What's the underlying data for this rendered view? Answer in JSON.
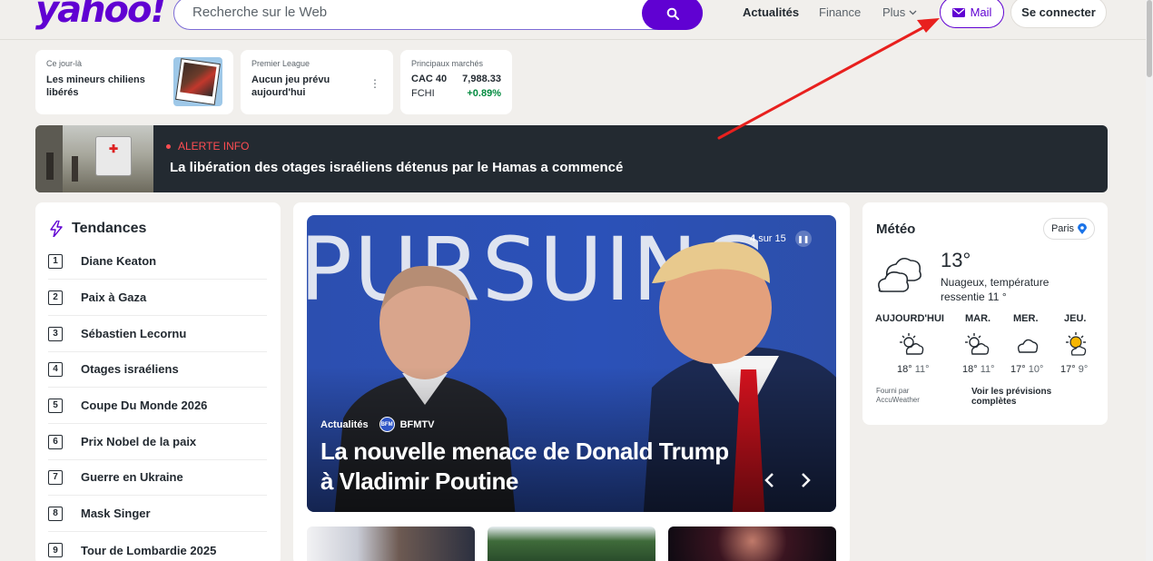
{
  "header": {
    "logo": "yahoo!",
    "search_placeholder": "Recherche sur le Web",
    "nav": [
      "Actualités",
      "Finance",
      "Plus"
    ],
    "mail_label": "Mail",
    "connect_label": "Se connecter"
  },
  "ticker": {
    "on_this_day": {
      "label": "Ce jour-là",
      "title": "Les mineurs chiliens libérés"
    },
    "sport": {
      "label": "Premier League",
      "title": "Aucun jeu prévu aujourd'hui"
    },
    "markets": {
      "label": "Principaux marchés",
      "rows": [
        {
          "name": "CAC 40",
          "value": "7,988.33"
        },
        {
          "name": "FCHI",
          "value": "+0.89%"
        }
      ]
    }
  },
  "breaking": {
    "label": "ALERTE INFO",
    "title": "La libération des otages israéliens détenus par le Hamas a commencé"
  },
  "trends": {
    "title": "Tendances",
    "items": [
      {
        "num": "1",
        "label": "Diane Keaton"
      },
      {
        "num": "2",
        "label": "Paix à Gaza"
      },
      {
        "num": "3",
        "label": "Sébastien Lecornu"
      },
      {
        "num": "4",
        "label": "Otages israéliens"
      },
      {
        "num": "5",
        "label": "Coupe Du Monde 2026"
      },
      {
        "num": "6",
        "label": "Prix Nobel de la paix"
      },
      {
        "num": "7",
        "label": "Guerre en Ukraine"
      },
      {
        "num": "8",
        "label": "Mask Singer"
      },
      {
        "num": "9",
        "label": "Tour de Lombardie 2025"
      }
    ]
  },
  "hero": {
    "bg_text": "PURSUING",
    "counter_current": "4",
    "counter_rest": "sur 15",
    "category": "Actualités",
    "source": "BFMTV",
    "source_logo": "BFM",
    "title": "La nouvelle menace de Donald Trump à Vladimir Poutine"
  },
  "weather": {
    "title": "Météo",
    "location": "Paris",
    "temp": "13°",
    "description": "Nuageux, température ressentie 11 °",
    "days": [
      {
        "day": "AUJOURD'HUI",
        "hi": "18°",
        "lo": "11°",
        "icon": "partly-sunny-icon"
      },
      {
        "day": "MAR.",
        "hi": "18°",
        "lo": "11°",
        "icon": "partly-sunny-icon"
      },
      {
        "day": "MER.",
        "hi": "17°",
        "lo": "10°",
        "icon": "cloud-icon"
      },
      {
        "day": "JEU.",
        "hi": "17°",
        "lo": "9°",
        "icon": "sun-cloud-icon"
      }
    ],
    "provider": "Fourni par AccuWeather",
    "more": "Voir les prévisions complètes"
  },
  "colors": {
    "brand": "#6001d2",
    "alert": "#ff4d52",
    "positive": "#008a3e",
    "annotation_arrow": "#e8201e"
  }
}
